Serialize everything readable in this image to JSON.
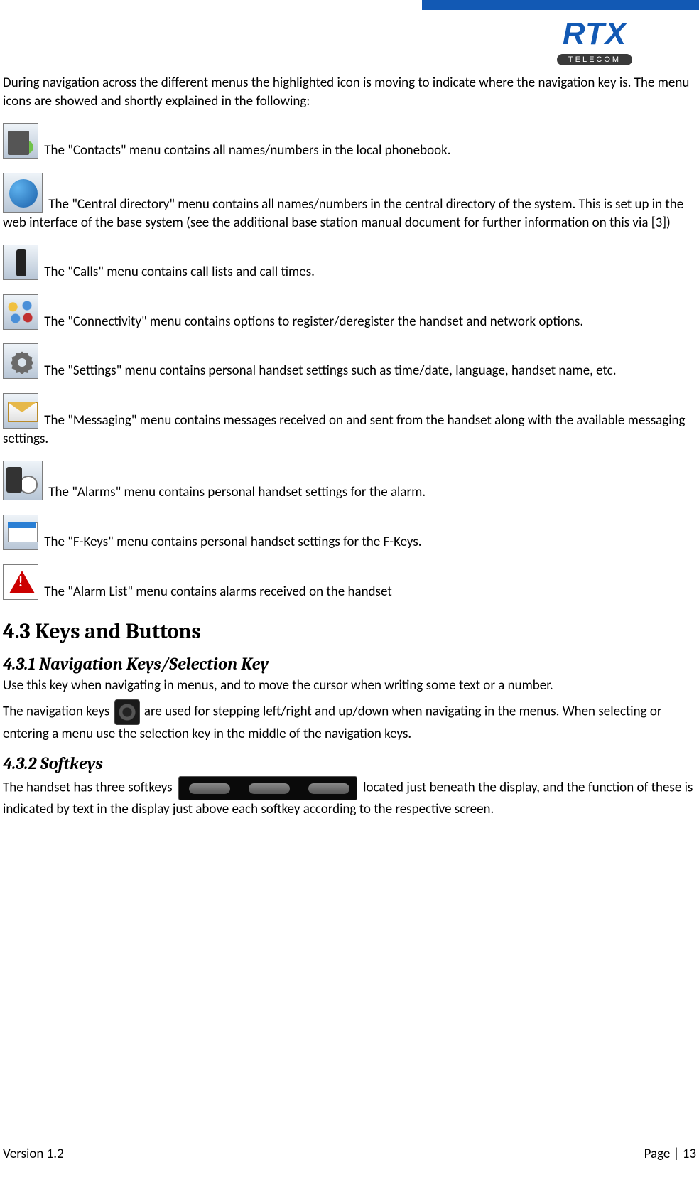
{
  "header": {
    "logo_text": "RTX",
    "logo_sub": "TELECOM"
  },
  "intro": "During navigation across the different menus the highlighted icon is moving to indicate where the navigation key is. The menu icons are showed and shortly explained in the following:",
  "items": [
    {
      "text": "The \"Contacts\" menu contains all names/numbers in the local phonebook."
    },
    {
      "text": "The \"Central directory\" menu contains all names/numbers in the central directory of the system. This is set up in the web interface of the base system (see the additional base station manual document for further information on this via [3])"
    },
    {
      "text": "The \"Calls\" menu contains call lists and call times."
    },
    {
      "text": "The \"Connectivity\" menu contains options to register/deregister the handset and network options."
    },
    {
      "text": "The \"Settings\" menu contains personal handset settings such as time/date, language, handset name, etc."
    },
    {
      "text": "The \"Messaging\" menu contains messages received on and sent from the handset along with the available messaging settings."
    },
    {
      "text": "The \"Alarms\" menu contains personal handset settings for the alarm."
    },
    {
      "text": "The \"F-Keys\" menu contains personal handset settings for the F-Keys."
    },
    {
      "text": "The \"Alarm List\" menu contains alarms received on the handset"
    }
  ],
  "section43": {
    "title": "4.3 Keys and Buttons",
    "s431": {
      "title": "4.3.1 Navigation Keys/Selection Key",
      "p1": "Use this key when navigating in menus, and to move the cursor when writing some text or a number.",
      "p2a": "The navigation keys ",
      "p2b": " are used for stepping left/right and up/down when navigating in the menus. When selecting or entering a menu use the selection key in the middle of the navigation keys."
    },
    "s432": {
      "title": "4.3.2 Softkeys",
      "p1a": "The handset has three softkeys ",
      "p1b": " located just beneath the display, and the function of these is indicated by text in the display just above each softkey according to the respective screen."
    }
  },
  "footer": {
    "version": "Version 1.2",
    "page": "Page | 13"
  }
}
